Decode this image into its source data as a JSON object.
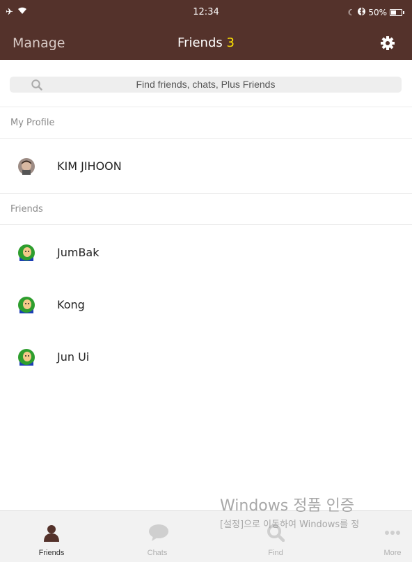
{
  "status_bar": {
    "time": "12:34",
    "battery": "50%",
    "left_icons": [
      "airplane-icon",
      "wifi-icon"
    ],
    "right_icons": [
      "moon-icon",
      "bluetooth-icon",
      "battery-icon"
    ]
  },
  "nav": {
    "left": "Manage",
    "title": "Friends",
    "count": "3",
    "right_icon": "gear-icon"
  },
  "search": {
    "placeholder": "Find friends, chats, Plus Friends",
    "icon": "search-icon"
  },
  "sections": {
    "profile_header": "My Profile",
    "friends_header": "Friends"
  },
  "profile": {
    "name": "KIM JIHOON"
  },
  "friends": [
    {
      "name": "JumBak"
    },
    {
      "name": "Kong"
    },
    {
      "name": "Jun Ui"
    }
  ],
  "tabs": [
    {
      "label": "Friends",
      "icon": "person-icon",
      "active": true
    },
    {
      "label": "Chats",
      "icon": "chat-bubble-icon",
      "active": false
    },
    {
      "label": "Find",
      "icon": "search-icon",
      "active": false
    },
    {
      "label": "More",
      "icon": "more-icon",
      "active": false
    }
  ],
  "watermark": {
    "line1": "Windows 정품 인증",
    "line2": "[설정]으로 이동하여 Windows를 정"
  },
  "colors": {
    "header_bg": "#54322b",
    "count_accent": "#ffe400",
    "active_tab_icon": "#54322b"
  }
}
